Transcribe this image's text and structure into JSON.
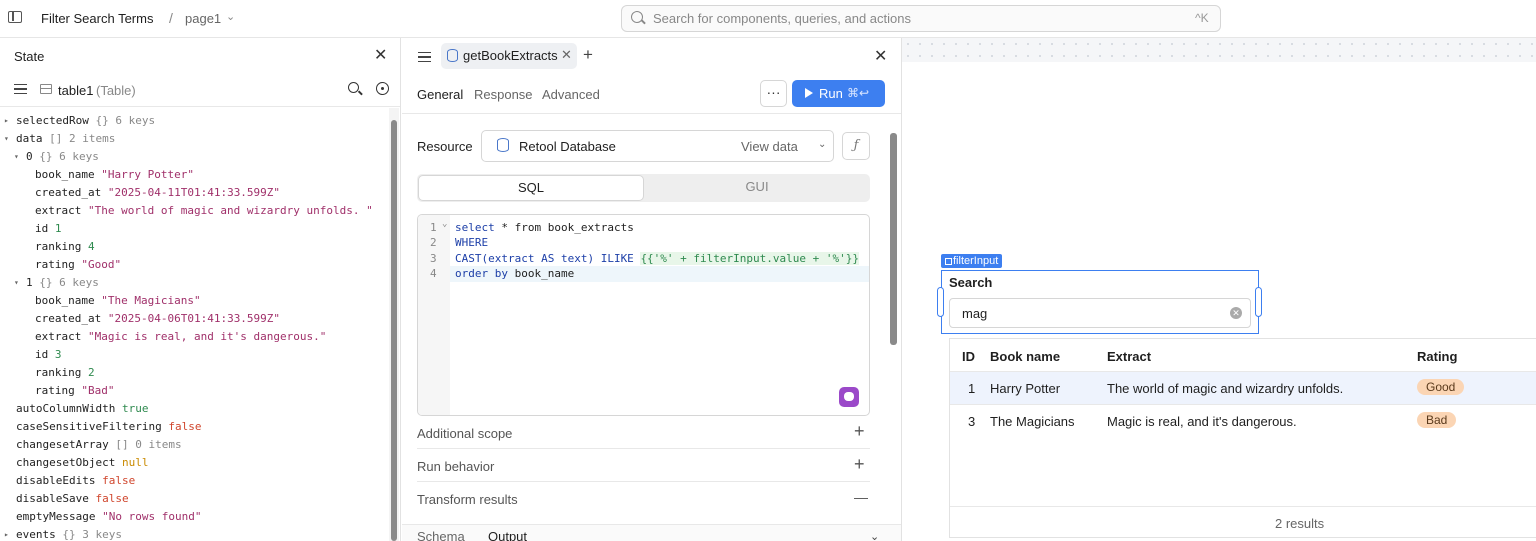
{
  "topbar": {
    "app_title": "Filter Search Terms",
    "separator": "/",
    "page": "page1",
    "search_placeholder": "Search for components, queries, and actions",
    "search_shortcut": "^K"
  },
  "state_panel": {
    "title": "State",
    "selected_component": "table1",
    "selected_type": "(Table)",
    "rows": [
      {
        "indent": 0,
        "arrow": "▸",
        "key": "selectedRow",
        "meta": "{}  6 keys"
      },
      {
        "indent": 0,
        "arrow": "▾",
        "key": "data",
        "meta": "[]  2 items"
      },
      {
        "indent": 1,
        "arrow": "▾",
        "key": "0",
        "meta": "{}  6 keys"
      },
      {
        "indent": 2,
        "key": "book_name",
        "value": "\"Harry Potter\"",
        "vtype": "s"
      },
      {
        "indent": 2,
        "key": "created_at",
        "value": "\"2025-04-11T01:41:33.599Z\"",
        "vtype": "s"
      },
      {
        "indent": 2,
        "key": "extract",
        "value": "\"The world of magic and wizardry unfolds. \"",
        "vtype": "s"
      },
      {
        "indent": 2,
        "key": "id",
        "value": "1",
        "vtype": "n"
      },
      {
        "indent": 2,
        "key": "ranking",
        "value": "4",
        "vtype": "n"
      },
      {
        "indent": 2,
        "key": "rating",
        "value": "\"Good\"",
        "vtype": "s"
      },
      {
        "indent": 1,
        "arrow": "▾",
        "key": "1",
        "meta": "{}  6 keys"
      },
      {
        "indent": 2,
        "key": "book_name",
        "value": "\"The Magicians\"",
        "vtype": "s"
      },
      {
        "indent": 2,
        "key": "created_at",
        "value": "\"2025-04-06T01:41:33.599Z\"",
        "vtype": "s"
      },
      {
        "indent": 2,
        "key": "extract",
        "value": "\"Magic is real, and it's dangerous.\"",
        "vtype": "s"
      },
      {
        "indent": 2,
        "key": "id",
        "value": "3",
        "vtype": "n"
      },
      {
        "indent": 2,
        "key": "ranking",
        "value": "2",
        "vtype": "n"
      },
      {
        "indent": 2,
        "key": "rating",
        "value": "\"Bad\"",
        "vtype": "s"
      },
      {
        "indent": 0,
        "key": "autoColumnWidth",
        "value": "true",
        "vtype": "n"
      },
      {
        "indent": 0,
        "key": "caseSensitiveFiltering",
        "value": "false",
        "vtype": "b"
      },
      {
        "indent": 0,
        "key": "changesetArray",
        "meta": "[]  0 items"
      },
      {
        "indent": 0,
        "key": "changesetObject",
        "value": "null",
        "vtype": "nl"
      },
      {
        "indent": 0,
        "key": "disableEdits",
        "value": "false",
        "vtype": "b"
      },
      {
        "indent": 0,
        "key": "disableSave",
        "value": "false",
        "vtype": "b"
      },
      {
        "indent": 0,
        "key": "emptyMessage",
        "value": "\"No rows found\"",
        "vtype": "s"
      },
      {
        "indent": 0,
        "arrow": "▸",
        "key": "events",
        "meta": "{}  3 keys"
      }
    ]
  },
  "query_panel": {
    "tab_label": "getBookExtracts",
    "tabs": [
      "General",
      "Response",
      "Advanced"
    ],
    "more_label": "···",
    "run_label": "Run",
    "run_shortcut": "⌘↩",
    "resource_label": "Resource",
    "resource_name": "Retool Database",
    "view_data": "View data",
    "fx_label": "ƒ",
    "modes": [
      "SQL",
      "GUI"
    ],
    "code_lines": [
      {
        "num": "1",
        "fold": "⌄"
      },
      {
        "num": "2"
      },
      {
        "num": "3"
      },
      {
        "num": "4"
      }
    ],
    "code": {
      "l1_kw1": "select",
      "l1_rest": " * from book_extracts",
      "l2": "WHERE",
      "l3_a": "CAST(extract AS text) ILIKE ",
      "l3_b": "{{'%' + filterInput.value + '%'}}",
      "l4_kw": "order by",
      "l4_rest": " book_name"
    },
    "sections": [
      {
        "label": "Additional scope",
        "icon": "+"
      },
      {
        "label": "Run behavior",
        "icon": "+"
      },
      {
        "label": "Transform results",
        "icon": "—"
      }
    ],
    "bottom_tabs": [
      "Schema",
      "Output"
    ]
  },
  "canvas": {
    "filter_label": "filterInput",
    "filter_title": "Search",
    "filter_value": "mag",
    "table": {
      "headers": [
        "ID",
        "Book name",
        "Extract",
        "Rating"
      ],
      "rows": [
        {
          "id": "1",
          "book_name": "Harry Potter",
          "extract": "The world of magic and wizardry unfolds.",
          "rating": "Good",
          "selected": true
        },
        {
          "id": "3",
          "book_name": "The Magicians",
          "extract": "Magic is real, and it's dangerous.",
          "rating": "Bad",
          "selected": false
        }
      ],
      "footer": "2 results"
    }
  },
  "colors": {
    "accent": "#3d7ff0",
    "pill": "#fbd5b4"
  }
}
